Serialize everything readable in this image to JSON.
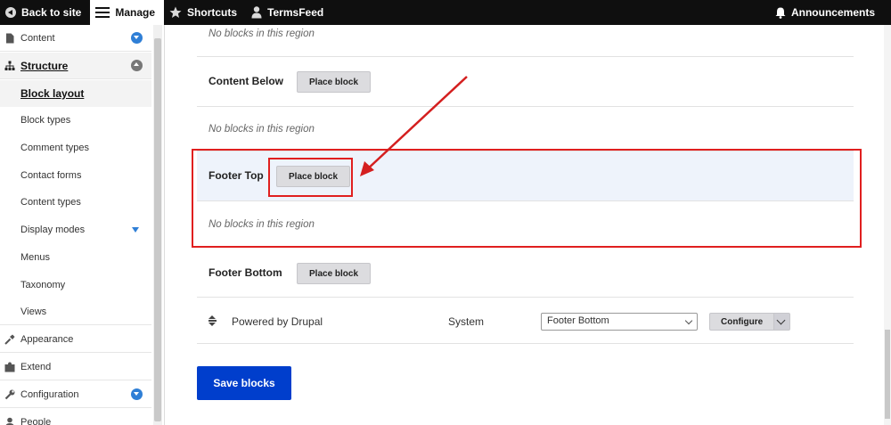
{
  "toolbar": {
    "back_to_site": "Back to site",
    "manage": "Manage",
    "shortcuts": "Shortcuts",
    "user": "TermsFeed",
    "announcements": "Announcements"
  },
  "sidebar": {
    "content": "Content",
    "structure": "Structure",
    "structure_items": [
      "Block layout",
      "Block types",
      "Comment types",
      "Contact forms",
      "Content types",
      "Display modes",
      "Menus",
      "Taxonomy",
      "Views"
    ],
    "appearance": "Appearance",
    "extend": "Extend",
    "configuration": "Configuration",
    "people": "People"
  },
  "main": {
    "empty_text": "No blocks in this region",
    "place_block": "Place block",
    "regions": {
      "content_below": "Content Below",
      "footer_top": "Footer Top",
      "footer_bottom": "Footer Bottom"
    },
    "block_row": {
      "name": "Powered by Drupal",
      "category": "System",
      "region_value": "Footer Bottom",
      "configure": "Configure"
    },
    "save": "Save blocks"
  },
  "colors": {
    "highlight": "#e01f1f",
    "primary": "#003ecc",
    "toggle": "#2f7fd6"
  }
}
